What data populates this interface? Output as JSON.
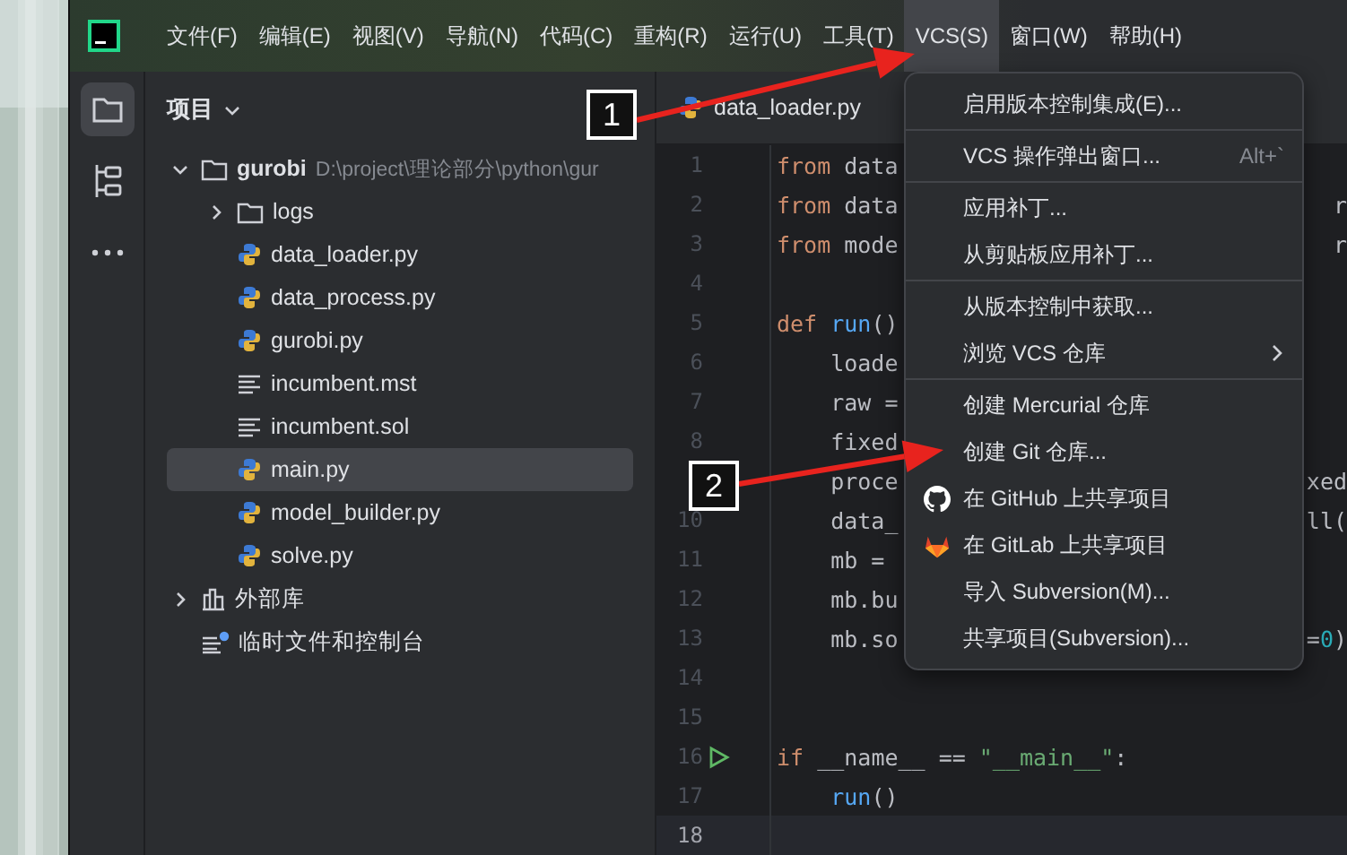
{
  "menu_bar": {
    "items": [
      {
        "label": "文件(F)",
        "selected": false
      },
      {
        "label": "编辑(E)",
        "selected": false
      },
      {
        "label": "视图(V)",
        "selected": false
      },
      {
        "label": "导航(N)",
        "selected": false
      },
      {
        "label": "代码(C)",
        "selected": false
      },
      {
        "label": "重构(R)",
        "selected": false
      },
      {
        "label": "运行(U)",
        "selected": false
      },
      {
        "label": "工具(T)",
        "selected": false
      },
      {
        "label": "VCS(S)",
        "selected": true
      },
      {
        "label": "窗口(W)",
        "selected": false
      },
      {
        "label": "帮助(H)",
        "selected": false
      }
    ]
  },
  "tool_strip": [
    {
      "kind": "project",
      "selected": true
    },
    {
      "kind": "structure",
      "selected": false
    },
    {
      "kind": "more",
      "selected": false
    }
  ],
  "project_panel": {
    "title": "项目",
    "tree": [
      {
        "label": "gurobi",
        "kind": "folder",
        "path": "D:\\project\\理论部分\\python\\gur",
        "expanded": true,
        "selected": false,
        "children": [
          {
            "label": "logs",
            "kind": "folder",
            "expanded": false,
            "selected": false
          },
          {
            "label": "data_loader.py",
            "kind": "python",
            "selected": false
          },
          {
            "label": "data_process.py",
            "kind": "python",
            "selected": false
          },
          {
            "label": "gurobi.py",
            "kind": "python",
            "selected": false
          },
          {
            "label": "incumbent.mst",
            "kind": "text",
            "selected": false
          },
          {
            "label": "incumbent.sol",
            "kind": "text",
            "selected": false
          },
          {
            "label": "main.py",
            "kind": "python",
            "selected": true
          },
          {
            "label": "model_builder.py",
            "kind": "python",
            "selected": false
          },
          {
            "label": "solve.py",
            "kind": "python",
            "selected": false
          }
        ]
      },
      {
        "label": "外部库",
        "kind": "library",
        "expanded": false,
        "selected": false
      },
      {
        "label": "临时文件和控制台",
        "kind": "scratch",
        "selected": false
      }
    ]
  },
  "editor": {
    "tab": "data_loader.py",
    "lines": [
      {
        "number": "1",
        "left": [
          {
            "kind": "keyword",
            "text": "from"
          },
          {
            "kind": "plain",
            "text": " data"
          }
        ]
      },
      {
        "number": "2",
        "left": [
          {
            "kind": "keyword",
            "text": "from"
          },
          {
            "kind": "plain",
            "text": " data"
          }
        ],
        "right": [
          {
            "kind": "plain",
            "text": "r"
          }
        ]
      },
      {
        "number": "3",
        "left": [
          {
            "kind": "keyword",
            "text": "from"
          },
          {
            "kind": "plain",
            "text": " mode"
          }
        ],
        "right": [
          {
            "kind": "plain",
            "text": "r"
          }
        ]
      },
      {
        "number": "4"
      },
      {
        "number": "5",
        "left": [
          {
            "kind": "keyword",
            "text": "def"
          },
          {
            "kind": "func",
            "text": " run"
          },
          {
            "kind": "plain",
            "text": "()"
          }
        ]
      },
      {
        "number": "6",
        "left": [
          {
            "kind": "plain",
            "text": "    loade"
          }
        ]
      },
      {
        "number": "7",
        "left": [
          {
            "kind": "plain",
            "text": "    raw ="
          }
        ]
      },
      {
        "number": "8",
        "left": [
          {
            "kind": "plain",
            "text": "    fixed"
          }
        ]
      },
      {
        "left": [
          {
            "kind": "plain",
            "text": "    proce"
          }
        ],
        "right": [
          {
            "kind": "plain",
            "text": "xed"
          }
        ]
      },
      {
        "number": "10",
        "left": [
          {
            "kind": "plain",
            "text": "    data_"
          }
        ],
        "right": [
          {
            "kind": "plain",
            "text": "ll("
          }
        ]
      },
      {
        "number": "11",
        "left": [
          {
            "kind": "plain",
            "text": "    mb ="
          }
        ]
      },
      {
        "number": "12",
        "left": [
          {
            "kind": "plain",
            "text": "    mb.bu"
          }
        ]
      },
      {
        "number": "13",
        "left": [
          {
            "kind": "plain",
            "text": "    mb.so"
          }
        ],
        "right": [
          {
            "kind": "plain",
            "text": "="
          },
          {
            "kind": "number",
            "text": "0"
          },
          {
            "kind": "plain",
            "text": ")"
          }
        ]
      },
      {
        "number": "14"
      },
      {
        "number": "15"
      },
      {
        "number": "16",
        "run_marker": true,
        "left": [
          {
            "kind": "keyword",
            "text": "if"
          },
          {
            "kind": "plain",
            "text": " __name__ == "
          },
          {
            "kind": "string",
            "text": "\"__main__\""
          },
          {
            "kind": "plain",
            "text": ":"
          }
        ]
      },
      {
        "number": "17",
        "left": [
          {
            "kind": "func",
            "text": "    run"
          },
          {
            "kind": "plain",
            "text": "()"
          }
        ]
      },
      {
        "number": "18",
        "current": true
      }
    ]
  },
  "vcs_menu": {
    "groups": [
      [
        {
          "kind": "plain",
          "label": "启用版本控制集成(E)..."
        }
      ],
      [
        {
          "kind": "plain",
          "label": "VCS 操作弹出窗口...",
          "shortcut": "Alt+`"
        }
      ],
      [
        {
          "kind": "plain",
          "label": "应用补丁..."
        },
        {
          "kind": "plain",
          "label": "从剪贴板应用补丁..."
        }
      ],
      [
        {
          "kind": "plain",
          "label": "从版本控制中获取..."
        },
        {
          "kind": "submenu",
          "label": "浏览 VCS 仓库"
        }
      ],
      [
        {
          "kind": "plain",
          "label": "创建 Mercurial 仓库"
        },
        {
          "kind": "plain",
          "label": "创建 Git 仓库..."
        },
        {
          "kind": "github",
          "label": "在 GitHub 上共享项目"
        },
        {
          "kind": "gitlab",
          "label": "在 GitLab 上共享项目"
        },
        {
          "kind": "plain",
          "label": "导入 Subversion(M)..."
        },
        {
          "kind": "plain",
          "label": "共享项目(Subversion)..."
        }
      ]
    ]
  },
  "annotations": [
    {
      "label": "1"
    },
    {
      "label": "2"
    }
  ]
}
